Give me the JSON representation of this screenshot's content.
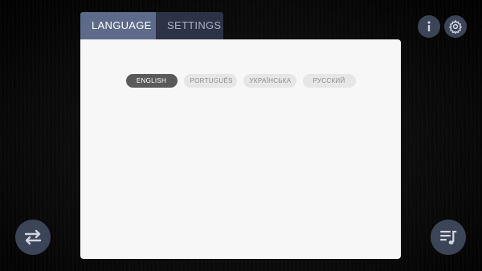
{
  "tabs": [
    {
      "label": "LANGUAGE",
      "active": true
    },
    {
      "label": "SETTINGS",
      "active": false
    }
  ],
  "languages": [
    {
      "label": "ENGLISH",
      "selected": true
    },
    {
      "label": "PORTUGUÊS",
      "selected": false
    },
    {
      "label": "УКРАЇНСЬКА",
      "selected": false
    },
    {
      "label": "РУССКИЙ",
      "selected": false
    }
  ],
  "buttons": {
    "info": {
      "icon": "info-icon"
    },
    "settings": {
      "icon": "gear-icon"
    },
    "swap": {
      "icon": "swap-arrows-icon"
    },
    "playlist": {
      "icon": "playlist-music-icon"
    }
  },
  "colors": {
    "tab_active": "#5d6a8a",
    "tab_inactive": "#2c3346",
    "panel": "#f7f7f7",
    "lang_selected": "#5a5a5a",
    "lang_unselected": "#e6e6e6",
    "circle_button": "#3c4457"
  }
}
